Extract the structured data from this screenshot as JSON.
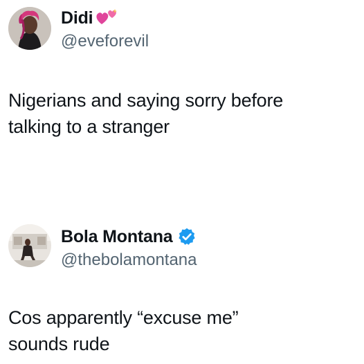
{
  "posts": [
    {
      "display_name": "Didi",
      "name_emoji": "pink-hearts-icon",
      "handle": "@eveforevil",
      "avatar": "user-avatar-icon",
      "text_lines": [
        "Nigerians and saying sorry before",
        "talking to a stranger"
      ]
    },
    {
      "display_name": "Bola Montana",
      "verified_badge": "verified-badge-icon",
      "handle": "@thebolamontana",
      "avatar": "user-avatar-icon",
      "text_lines": [
        "Cos apparently “excuse me”",
        "sounds rude"
      ]
    }
  ],
  "colors": {
    "text": "#0f1419",
    "secondary": "#536471",
    "verified": "#1d9bf0",
    "heart": "#e0459b"
  }
}
